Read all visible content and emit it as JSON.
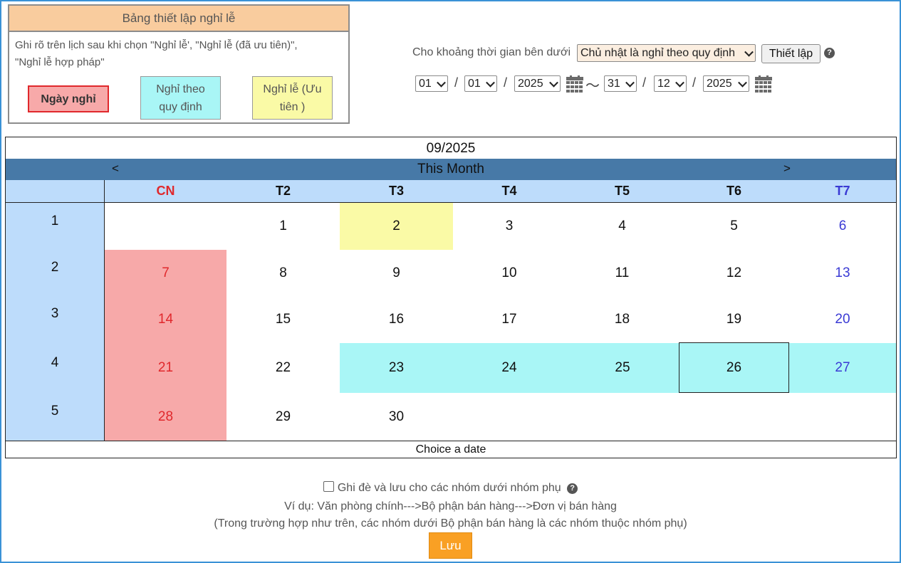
{
  "legend": {
    "title": "Bảng thiết lập nghỉ lễ",
    "description_line1": "Ghi rõ trên lịch sau khi chọn \"Nghỉ lễ', \"Nghỉ lễ (đã ưu tiên)\",",
    "description_line2": "\"Nghỉ lễ hợp pháp\"",
    "btn_off": "Ngày nghỉ",
    "btn_rule_line1": "Nghỉ theo",
    "btn_rule_line2": "quy định",
    "btn_prio_line1": "Nghỉ lễ (Ưu",
    "btn_prio_line2": "tiên )"
  },
  "settings": {
    "label": "Cho khoảng thời gian bên dưới",
    "rule_select": "Chủ nhật là nghỉ theo quy định",
    "setup_button": "Thiết lập",
    "from": {
      "day": "01",
      "month": "01",
      "year": "2025"
    },
    "to": {
      "day": "31",
      "month": "12",
      "year": "2025"
    },
    "slash": "/",
    "tilde": "～"
  },
  "calendar": {
    "month": "09/2025",
    "prev": "<",
    "next": ">",
    "nav_title": "This Month",
    "weekdays": [
      "CN",
      "T2",
      "T3",
      "T4",
      "T5",
      "T6",
      "T7"
    ],
    "weeks": [
      "1",
      "2",
      "3",
      "4",
      "5"
    ],
    "days": [
      [
        "",
        "1",
        "2",
        "3",
        "4",
        "5",
        "6"
      ],
      [
        "7",
        "8",
        "9",
        "10",
        "11",
        "12",
        "13"
      ],
      [
        "14",
        "15",
        "16",
        "17",
        "18",
        "19",
        "20"
      ],
      [
        "21",
        "22",
        "23",
        "24",
        "25",
        "26",
        "27"
      ],
      [
        "28",
        "29",
        "30",
        "",
        "",
        "",
        ""
      ]
    ],
    "footer": "Choice a date",
    "colors": {
      "off": "#f7a9a9",
      "rule": "#a9f6f6",
      "priority": "#fafaa6",
      "week_bg": "#bddcfb",
      "nav_bg": "#4779a7"
    }
  },
  "bottom": {
    "override_label": "Ghi đè và lưu cho các nhóm dưới nhóm phụ",
    "example": "Ví dụ: Văn phòng chính--->Bộ phận bán hàng--->Đơn vị bán hàng",
    "explanation": "(Trong trường hợp như trên, các nhóm dưới Bộ phận bán hàng là các nhóm thuộc nhóm phụ)",
    "save": "Lưu"
  },
  "icons": {
    "help": "?"
  }
}
